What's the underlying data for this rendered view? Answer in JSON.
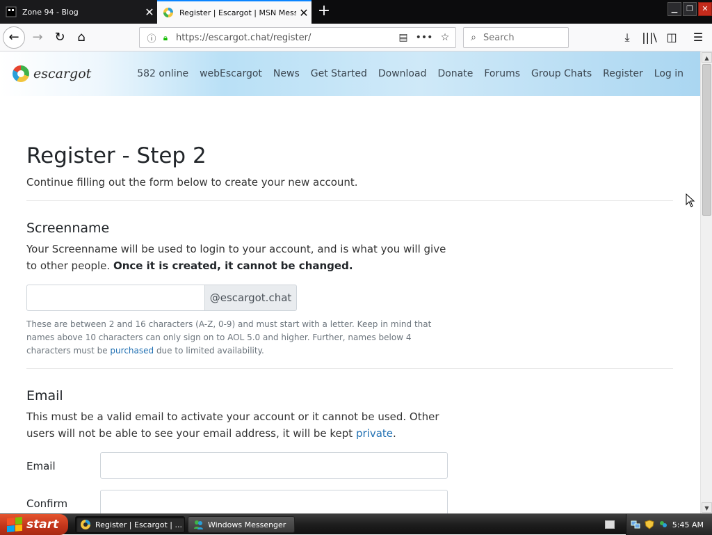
{
  "browser": {
    "tabs": [
      {
        "title": "Zone 94 - Blog",
        "active": false
      },
      {
        "title": "Register | Escargot | MSN Messen",
        "active": true
      }
    ],
    "url": "https://escargot.chat/register/",
    "search_placeholder": "Search"
  },
  "site": {
    "logo_text": "escargot",
    "nav": [
      "582 online",
      "webEscargot",
      "News",
      "Get Started",
      "Download",
      "Donate",
      "Forums",
      "Group Chats",
      "Register",
      "Log in"
    ]
  },
  "page": {
    "title": "Register - Step 2",
    "lead": "Continue filling out the form below to create your new account.",
    "screenname": {
      "heading": "Screenname",
      "desc_1": "Your Screenname will be used to login to your account, and is what you will give to other people. ",
      "desc_bold": "Once it is created, it cannot be changed.",
      "input_value": "",
      "addon": "@escargot.chat",
      "help_1": "These are between 2 and 16 characters (A-Z, 0-9) and must start with a letter. Keep in mind that names above 10 characters can only sign on to AOL 5.0 and higher. Further, names below 4 characters must be ",
      "help_link": "purchased",
      "help_2": " due to limited availability."
    },
    "email": {
      "heading": "Email",
      "desc_1": "This must be a valid email to activate your account or it cannot be used. Other users will not be able to see your email address, it will be kept ",
      "desc_link": "private",
      "desc_2": ".",
      "email_label": "Email",
      "confirm_label": "Confirm",
      "email_value": "",
      "confirm_value": ""
    }
  },
  "taskbar": {
    "start_label": "start",
    "tasks": [
      "Register | Escargot | ...",
      "Windows Messenger"
    ],
    "clock": "5:45 AM"
  },
  "colors": {
    "link": "#1f6fb2",
    "tab_accent": "#0a84ff",
    "secure_lock": "#12bc00"
  }
}
